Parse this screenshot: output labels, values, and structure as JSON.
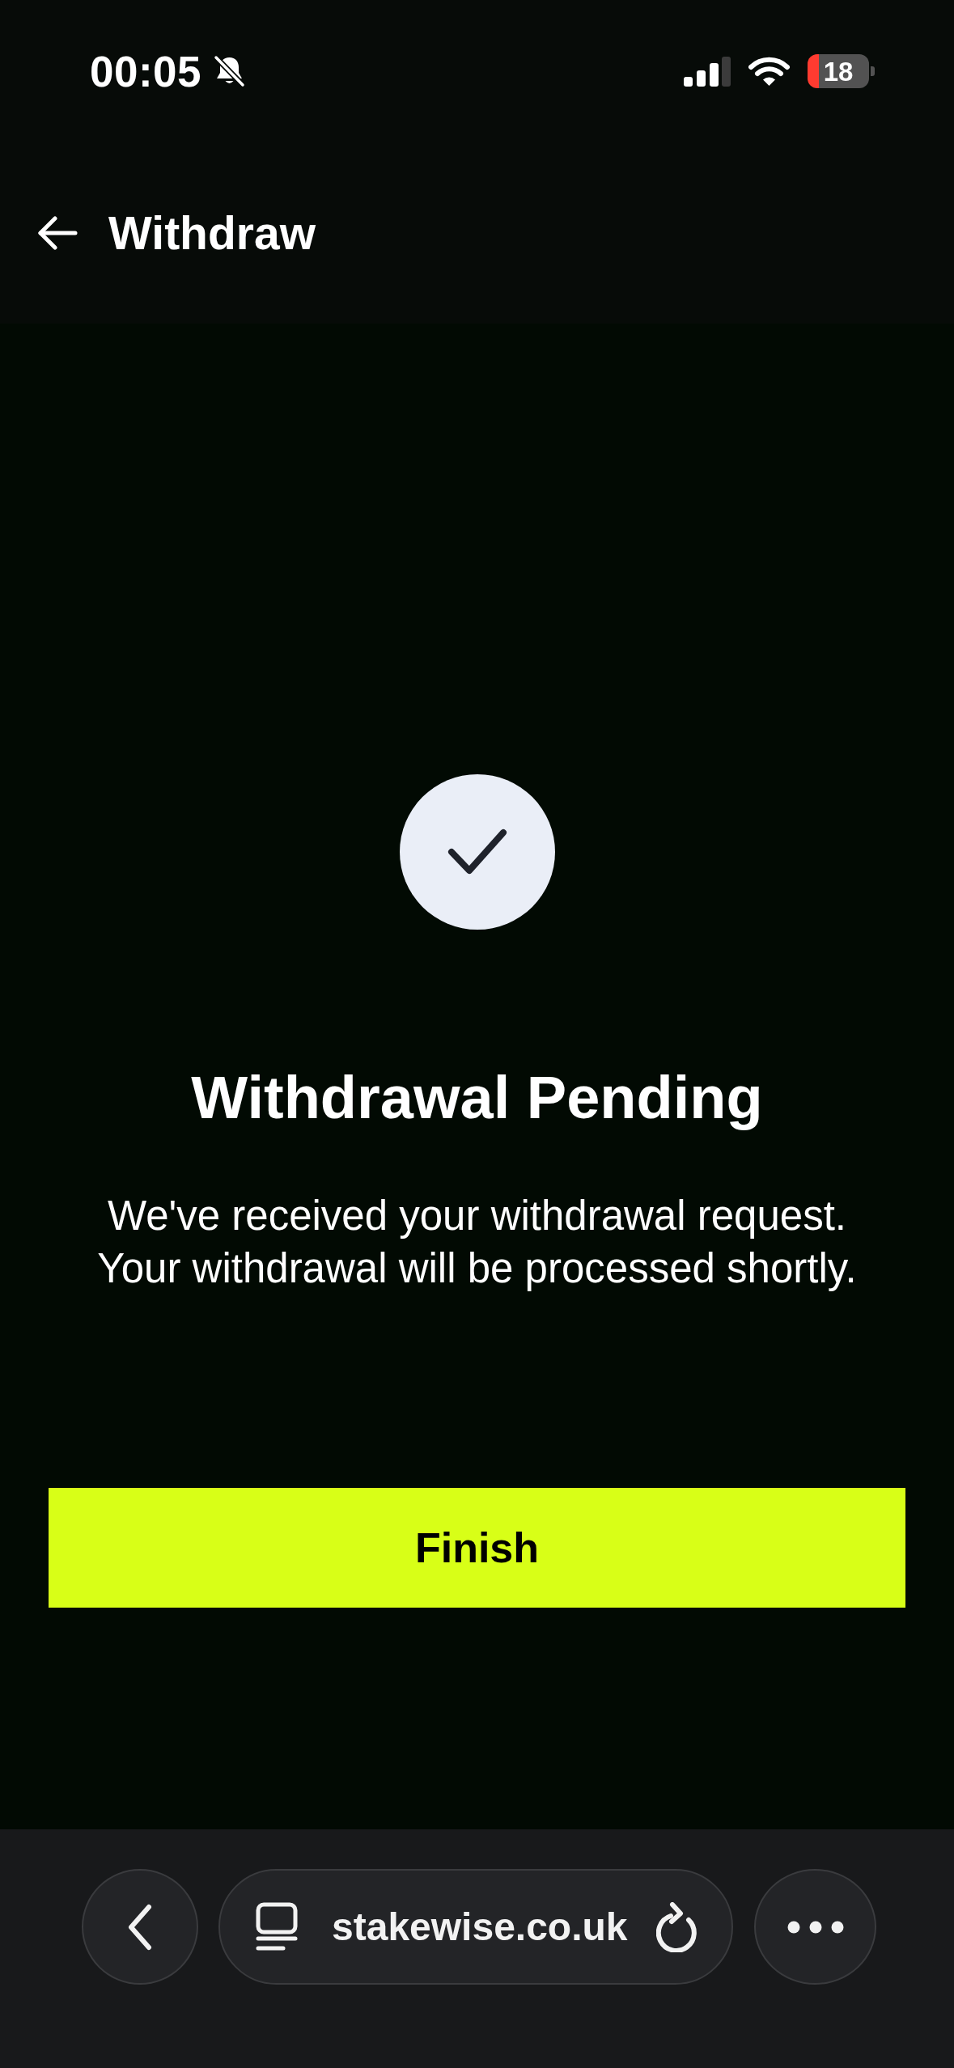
{
  "status_bar": {
    "time": "00:05",
    "battery": "18"
  },
  "header": {
    "title": "Withdraw"
  },
  "confirmation": {
    "title": "Withdrawal Pending",
    "message": "We've received your withdrawal request. Your withdrawal will be processed shortly."
  },
  "primary_button": {
    "label": "Finish"
  },
  "browser_bar": {
    "url": "stakewise.co.uk"
  }
}
